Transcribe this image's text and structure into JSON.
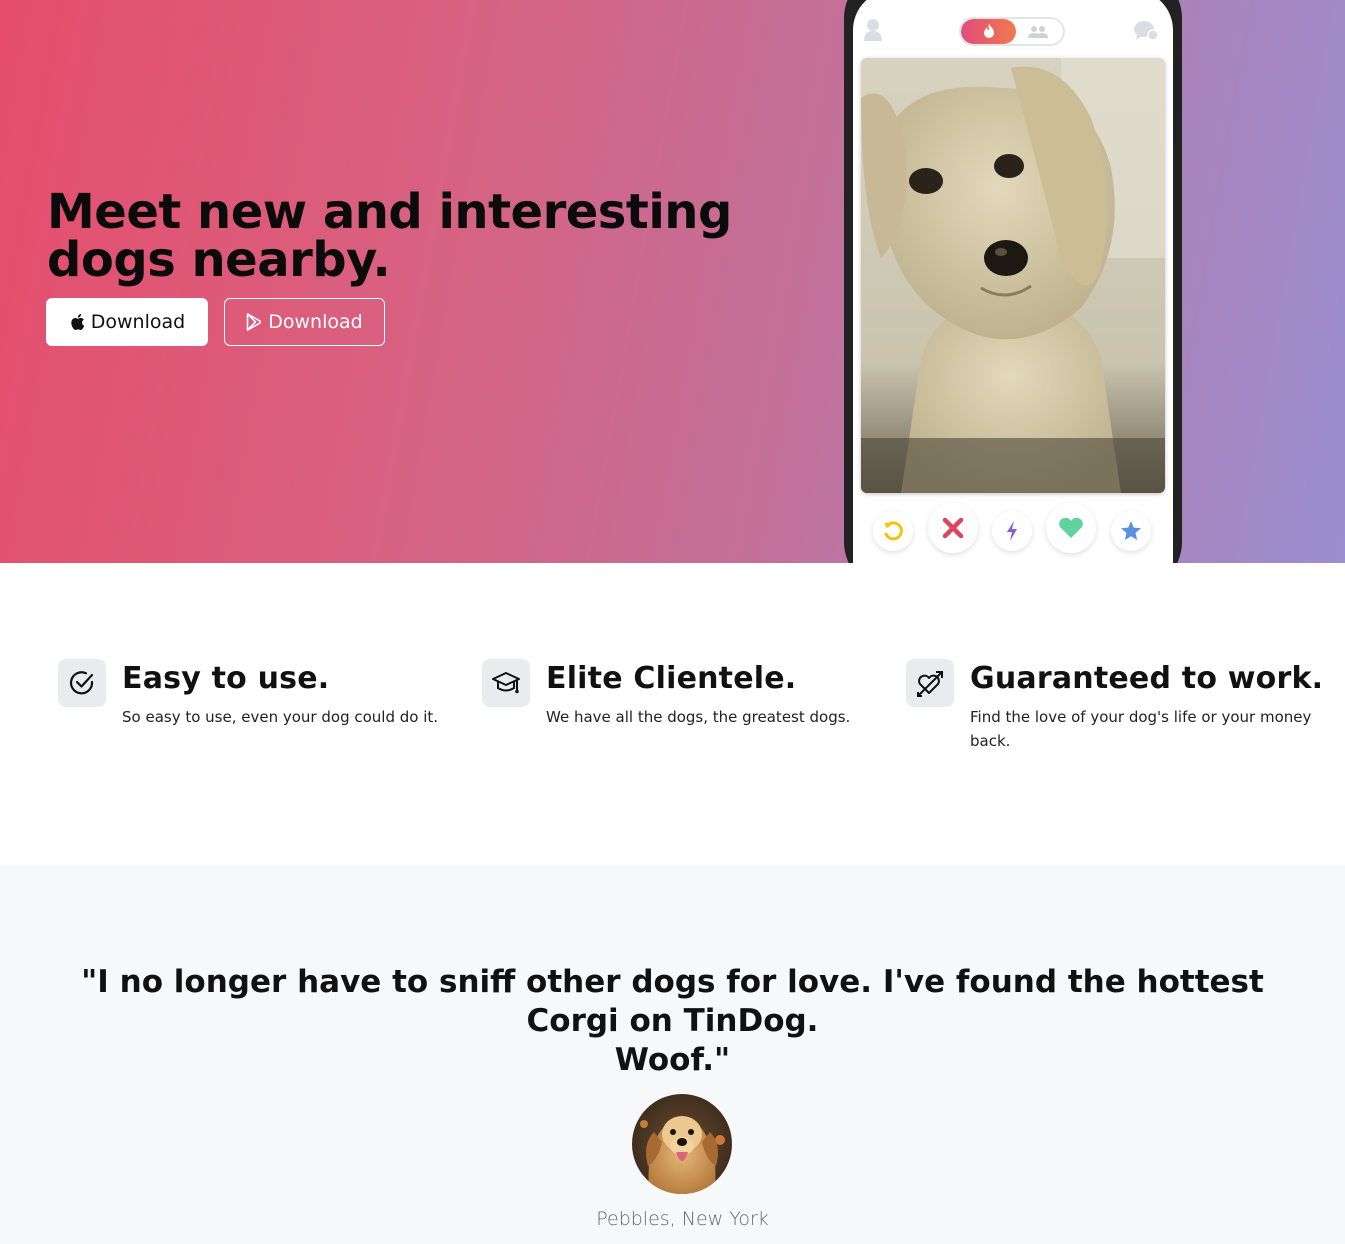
{
  "hero": {
    "title_line1": "Meet new and interesting",
    "title_line2": "dogs nearby.",
    "apple_button_label": "Download",
    "play_button_label": "Download"
  },
  "phone": {
    "actions": [
      "rewind-icon",
      "nope-icon",
      "boost-icon",
      "like-icon",
      "super-like-icon"
    ],
    "colors": {
      "rewind": "#f2c40f",
      "nope": "#e0445a",
      "boost": "#8a5bd6",
      "like": "#5fd2a0",
      "super_like": "#5b8fe0"
    }
  },
  "features": [
    {
      "icon": "check-circle-icon",
      "title": "Easy to use.",
      "desc": "So easy to use, even your dog could do it."
    },
    {
      "icon": "graduation-cap-icon",
      "title": "Elite Clientele.",
      "desc": "We have all the dogs, the greatest dogs."
    },
    {
      "icon": "heart-arrow-icon",
      "title": "Guaranteed to work.",
      "desc_line1": "Find the love of your dog's life or your money",
      "desc_line2": "back."
    }
  ],
  "testimonial": {
    "quote_line1": "\"I no longer have to sniff other dogs for love. I've found the hottest Corgi on TinDog.",
    "quote_line2": "Woof.\"",
    "caption": "Pebbles, New York"
  }
}
